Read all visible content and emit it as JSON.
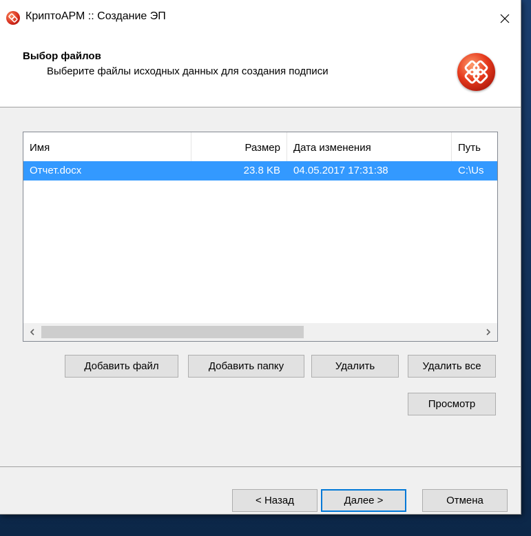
{
  "window": {
    "title": "КриптоАРМ :: Создание ЭП"
  },
  "header": {
    "title": "Выбор файлов",
    "subtitle": "Выберите файлы исходных данных для создания подписи"
  },
  "file_list": {
    "columns": [
      "Имя",
      "Размер",
      "Дата изменения",
      "Путь"
    ],
    "rows": [
      {
        "name": "Отчет.docx",
        "size": "23.8 KB",
        "modified": "04.05.2017 17:31:38",
        "path": "C:\\Us"
      }
    ]
  },
  "buttons": {
    "add_file": "Добавить файл",
    "add_folder": "Добавить папку",
    "delete": "Удалить",
    "delete_all": "Удалить все",
    "preview": "Просмотр"
  },
  "footer": {
    "back": "< Назад",
    "next": "Далее >",
    "cancel": "Отмена"
  },
  "icons": {
    "app": "kriptoarm-app-icon",
    "logo": "kriptoarm-logo-icon",
    "close": "close-icon",
    "scroll_left": "chevron-left-icon",
    "scroll_right": "chevron-right-icon"
  },
  "colors": {
    "selection": "#3399ff",
    "default_button_border": "#0078d7",
    "logo_red": "#e5391c"
  }
}
